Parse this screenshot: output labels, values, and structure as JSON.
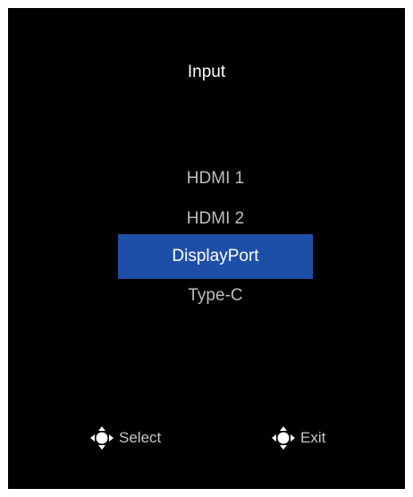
{
  "osd": {
    "title": "Input",
    "items": [
      {
        "label": "HDMI 1",
        "selected": false
      },
      {
        "label": "HDMI 2",
        "selected": false
      },
      {
        "label": "DisplayPort",
        "selected": true
      },
      {
        "label": "Type-C",
        "selected": false
      }
    ],
    "hints": {
      "select": {
        "icon": "navigation-pad-icon",
        "label": "Select"
      },
      "exit": {
        "icon": "navigation-pad-icon",
        "label": "Exit"
      }
    },
    "colors": {
      "background": "#000000",
      "selected_bg": "#1e4fa8",
      "text": "#bdbdbd",
      "selected_text": "#ffffff"
    }
  }
}
